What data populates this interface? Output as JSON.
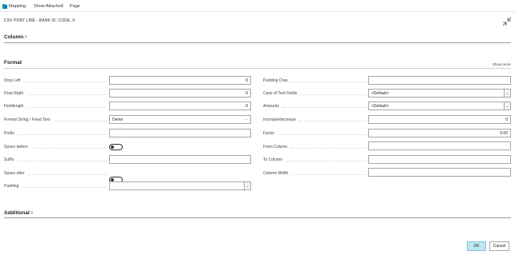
{
  "actionbar": {
    "items": [
      {
        "label": "Mapping",
        "icon": "mapping-icon"
      },
      {
        "label": "Show Attached"
      },
      {
        "label": "Page"
      }
    ]
  },
  "page": {
    "title": "CSV PORT LINE - BANK ID: CODE, 0"
  },
  "sections": {
    "column": {
      "title": "Column",
      "chevron": ">"
    },
    "format": {
      "title": "Format",
      "show_more": "Show more"
    },
    "additional": {
      "title": "Additional",
      "chevron": ">"
    }
  },
  "left_fields": [
    {
      "label": "Drop Left",
      "value": "0"
    },
    {
      "label": "Drop Right",
      "value": "0"
    },
    {
      "label": "Fieldlength",
      "value": "0"
    },
    {
      "label": "Format String / Fixed Text",
      "value": "Demo",
      "suffix": "..."
    },
    {
      "label": "Prefix",
      "value": ""
    },
    {
      "label": "Space before",
      "toggle": "off"
    },
    {
      "label": "Suffix",
      "value": ""
    },
    {
      "label": "Space after",
      "toggle": "off"
    },
    {
      "label": "Padding",
      "value": ""
    }
  ],
  "right_fields": [
    {
      "label": "Padding Char.",
      "value": ""
    },
    {
      "label": "Case of Text Fields",
      "value": "<Default>"
    },
    {
      "label": "Amounts",
      "value": "<Default>"
    },
    {
      "label": "increase/decrease",
      "value": "0"
    },
    {
      "label": "Factor",
      "value": "0.00"
    },
    {
      "label": "From Column",
      "value": ""
    },
    {
      "label": "To Column",
      "value": ""
    },
    {
      "label": "Column Width",
      "value": ""
    }
  ],
  "buttons": {
    "ok": "OK",
    "cancel": "Cancel"
  },
  "colors": {
    "accent": "#00a19a",
    "ok_button_bg": "#bfe6f0"
  }
}
